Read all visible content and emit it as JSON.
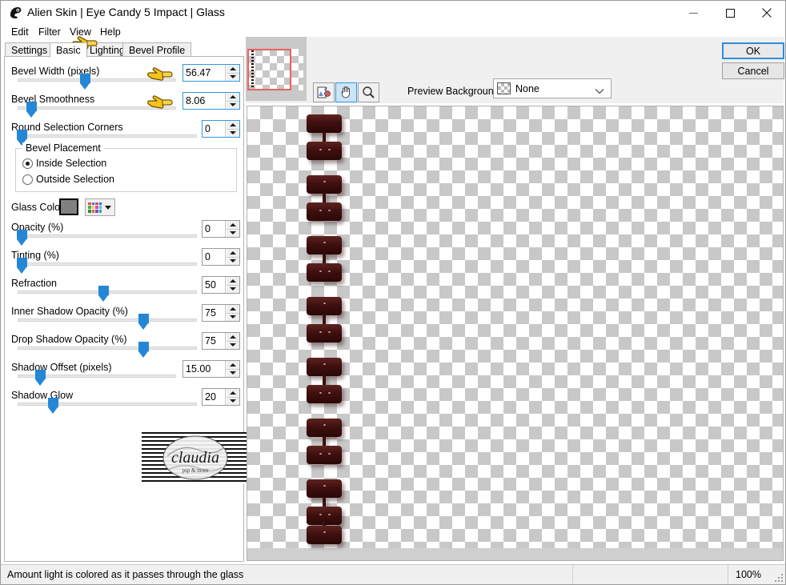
{
  "window": {
    "title": "Alien Skin | Eye Candy 5 Impact | Glass",
    "app_icon": "alien-skin-logo-icon",
    "minimize": "–",
    "maximize": "□",
    "close": "✕"
  },
  "menu": [
    {
      "label": "Edit"
    },
    {
      "label": "Filter"
    },
    {
      "label": "View"
    },
    {
      "label": "Help"
    }
  ],
  "tabs": [
    {
      "label": "Settings",
      "active": false
    },
    {
      "label": "Basic",
      "active": true
    },
    {
      "label": "Lighting",
      "active": false
    },
    {
      "label": "Bevel Profile",
      "active": false
    }
  ],
  "controls": {
    "bevel_width": {
      "label": "Bevel Width (pixels)",
      "value": "56.47",
      "pct": 47
    },
    "bevel_smoothness": {
      "label": "Bevel Smoothness",
      "value": "8.06",
      "pct": 8
    },
    "round_corners": {
      "label": "Round Selection Corners",
      "value": "0",
      "pct": 0
    },
    "opacity": {
      "label": "Opacity (%)",
      "value": "0",
      "pct": 0
    },
    "tinting": {
      "label": "Tinting (%)",
      "value": "0",
      "pct": 0
    },
    "refraction": {
      "label": "Refraction",
      "value": "50",
      "pct": 50
    },
    "inner_shadow": {
      "label": "Inner Shadow Opacity (%)",
      "value": "75",
      "pct": 75
    },
    "drop_shadow": {
      "label": "Drop Shadow Opacity (%)",
      "value": "75",
      "pct": 75
    },
    "shadow_offset": {
      "label": "Shadow Offset (pixels)",
      "value": "15.00",
      "pct": 15
    },
    "shadow_glow": {
      "label": "Shadow Glow",
      "value": "20",
      "pct": 20
    }
  },
  "bevel_placement": {
    "title": "Bevel Placement",
    "options": [
      {
        "label": "Inside Selection",
        "selected": true
      },
      {
        "label": "Outside Selection",
        "selected": false
      }
    ]
  },
  "glass_color": {
    "label": "Glass Color",
    "swatch_hex": "#808080",
    "picker_icon": "color-palette-grid-icon",
    "caret_icon": "chevron-down-icon"
  },
  "toolbar": {
    "navigator_thumbnail": "navigator-thumbnail",
    "buttons": [
      {
        "name": "preview-toggle-icon"
      },
      {
        "name": "hand-pan-icon",
        "selected": true
      },
      {
        "name": "zoom-magnifier-icon"
      }
    ],
    "preview_background": {
      "label": "Preview Background:",
      "value": "None",
      "swatch_icon": "checker-swatch-icon",
      "caret_icon": "chevron-down-icon"
    }
  },
  "dialog_buttons": {
    "ok": "OK",
    "cancel": "Cancel"
  },
  "statusbar": {
    "message": "Amount light is colored as it passes through the glass",
    "zoom": "100%",
    "grip_icon": "resize-grip-icon"
  },
  "watermark": {
    "text": "claudia",
    "subtext": "psp & more"
  },
  "cursor_pointers": [
    {
      "name": "hand-pointer-cursor"
    },
    {
      "name": "hand-pointer-cursor"
    },
    {
      "name": "hand-pointer-cursor"
    }
  ]
}
